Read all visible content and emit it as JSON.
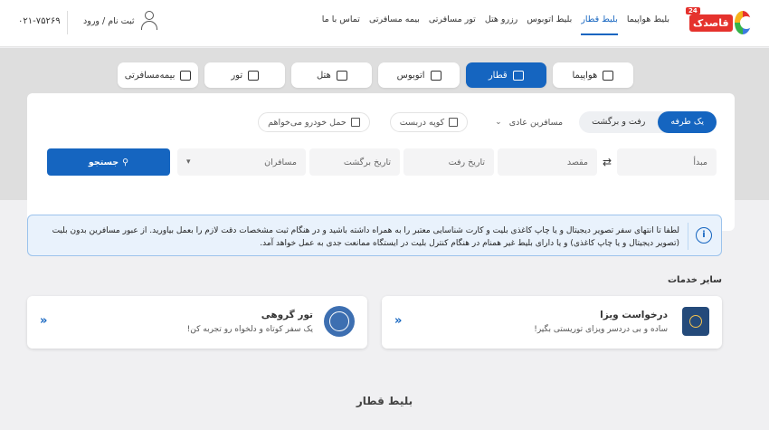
{
  "header": {
    "logo_text": "قاصدک",
    "logo_badge": "24",
    "nav": [
      {
        "label": "بلیط هواپیما"
      },
      {
        "label": "بلیط قطار"
      },
      {
        "label": "بلیط اتوبوس"
      },
      {
        "label": "رزرو هتل"
      },
      {
        "label": "تور مسافرتی"
      },
      {
        "label": "بیمه مسافرتی"
      },
      {
        "label": "تماس با ما"
      }
    ],
    "active_nav": "بلیط قطار",
    "login_label": "ثبت نام / ورود",
    "phone": "۰۲۱-۷۵۲۶۹"
  },
  "tabs": [
    {
      "label": "هواپیما",
      "icon": "plane-icon"
    },
    {
      "label": "قطار",
      "icon": "train-icon",
      "active": true
    },
    {
      "label": "اتوبوس",
      "icon": "bus-icon"
    },
    {
      "label": "هتل",
      "icon": "hotel-icon"
    },
    {
      "label": "تور",
      "icon": "tour-icon"
    },
    {
      "label": "بیمه‌مسافرتی",
      "icon": "umbrella-icon"
    }
  ],
  "search": {
    "trip_one_way": "یک طرفه",
    "trip_round": "رفت و برگشت",
    "passenger_type": "مسافرین عادی",
    "coupe": "کوپه دربست",
    "car_transport": "حمل خودرو می‌خواهم",
    "origin_placeholder": "مبدأ",
    "dest_placeholder": "مقصد",
    "depart_placeholder": "تاریخ رفت",
    "return_placeholder": "تاریخ برگشت",
    "passengers_label": "مسافران",
    "search_button": "جستجو"
  },
  "info": {
    "icon": "info-icon",
    "line1": "لطفا تا انتهای سفر تصویر دیجیتال و یا چاپ کاغذی بلیت و کارت شناسایی معتبر را به همراه داشته باشید و در هنگام ثبت مشخصات دقت لازم را بعمل بیاورید. از عبور مسافرین بدون بلیت",
    "line2": "(تصویر دیجیتال و یا چاپ کاغذی) و یا دارای بلیط غیر همنام در هنگام کنترل بلیت در ایستگاه ممانعت جدی به عمل خواهد آمد."
  },
  "services": {
    "title": "سایر خدمات",
    "visa": {
      "title": "درخواست ویزا",
      "subtitle": "ساده و بی دردسر ویزای توریستی بگیر!",
      "icon": "passport-icon"
    },
    "tour": {
      "title": "تور گروهی",
      "subtitle": "یک سفر کوتاه و دلخواه رو تجربه کن!",
      "icon": "globe-icon"
    }
  },
  "bottom_title": "بلیط قطار",
  "colors": {
    "primary": "#1565c0",
    "brand_red": "#e5322d"
  }
}
